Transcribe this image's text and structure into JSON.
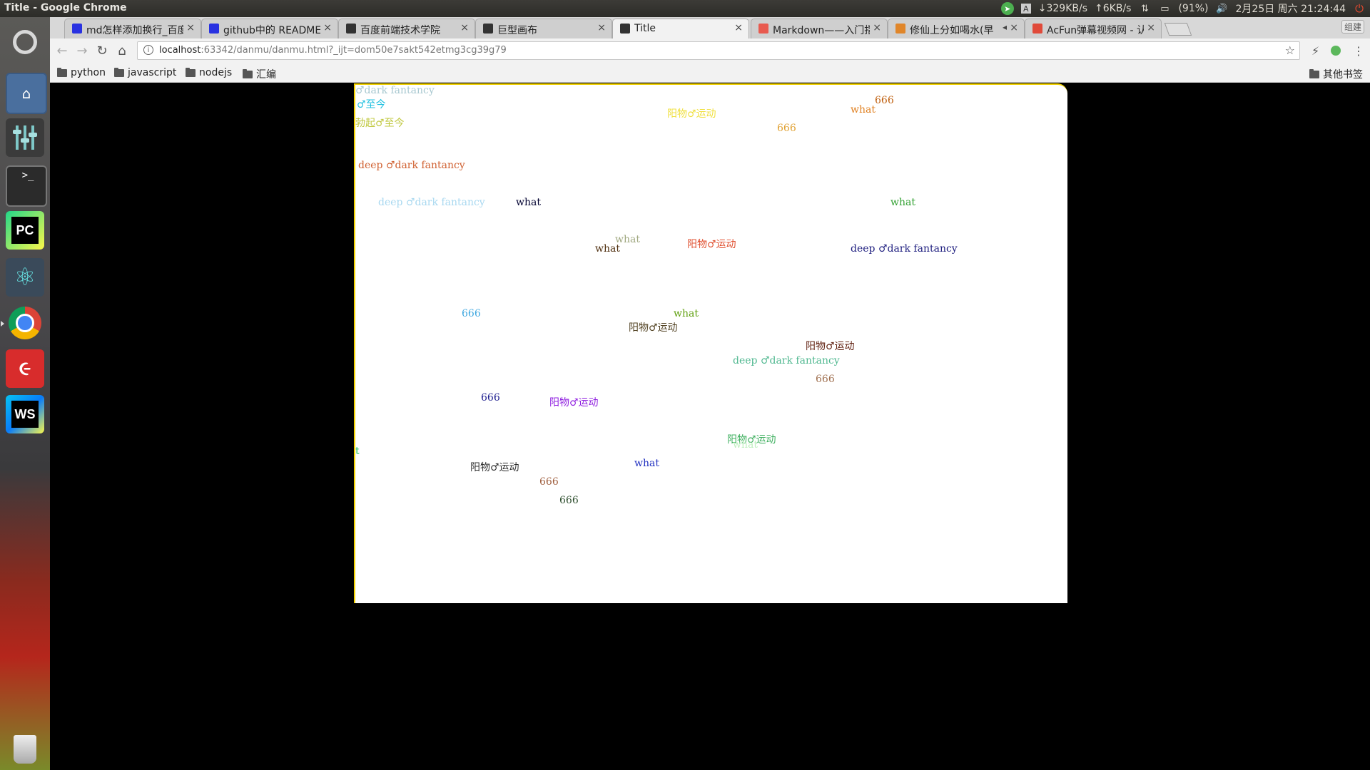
{
  "system": {
    "window_title": "Title - Google Chrome",
    "net_down": "↓329KB/s",
    "net_up": "↑6KB/s",
    "battery": "(91%)",
    "datetime": "2月25日 周六 21:24:44",
    "input_method": "A"
  },
  "launcher": {
    "apps": [
      "ubuntu-dash",
      "files",
      "mixer",
      "terminal",
      "pycharm",
      "atom",
      "chrome",
      "netease-music",
      "webstorm",
      "trash"
    ],
    "terminal_prompt": ">_",
    "pycharm_label": "PC",
    "webstorm_label": "WS"
  },
  "tabs": [
    {
      "label": "md怎样添加换行_百度",
      "favicon": "paw",
      "color": "#2932e1"
    },
    {
      "label": "github中的 README",
      "favicon": "paw",
      "color": "#2932e1"
    },
    {
      "label": "百度前端技术学院",
      "favicon": "circle",
      "color": "#333333"
    },
    {
      "label": "巨型画布",
      "favicon": "circle",
      "color": "#333333"
    },
    {
      "label": "Title",
      "favicon": "ws",
      "color": "#333333",
      "active": true
    },
    {
      "label": "Markdown——入门指",
      "favicon": "md",
      "color": "#e85a4f"
    },
    {
      "label": "修仙上分如喝水(早",
      "favicon": "dy",
      "color": "#e0862a",
      "muted": true
    },
    {
      "label": "AcFun弹幕视频网 - 认",
      "favicon": "ac",
      "color": "#e04a3a"
    }
  ],
  "profile_label": "组建",
  "address_bar": {
    "host": "localhost",
    "rest": ":63342/danmu/danmu.html?_ijt=dom50e7sakt542etmg3cg39g79"
  },
  "bookmarks": [
    "python",
    "javascript",
    "nodejs",
    "汇编"
  ],
  "other_bookmarks": "其他书签",
  "danmu": [
    {
      "text": "♂dark fantancy",
      "color": "#a8c8d0"
    },
    {
      "text": "♂至今",
      "color": "#20c0e0"
    },
    {
      "text": "勃起♂至今",
      "color": "#c0c840"
    },
    {
      "text": "阳物♂运动",
      "color": "#f0e040"
    },
    {
      "text": "what",
      "color": "#e08020"
    },
    {
      "text": "666",
      "color": "#c06010"
    },
    {
      "text": "666",
      "color": "#e0a030"
    },
    {
      "text": "deep ♂dark fantancy",
      "color": "#d06030"
    },
    {
      "text": "deep ♂dark fantancy",
      "color": "#a8d8f0"
    },
    {
      "text": "what",
      "color": "#000030"
    },
    {
      "text": "what",
      "color": "#30a030"
    },
    {
      "text": "what",
      "color": "#a0a880"
    },
    {
      "text": "what",
      "color": "#503010"
    },
    {
      "text": "阳物♂运动",
      "color": "#e05030"
    },
    {
      "text": "deep ♂dark fantancy",
      "color": "#202080"
    },
    {
      "text": "666",
      "color": "#40a8e0"
    },
    {
      "text": "what",
      "color": "#60a010"
    },
    {
      "text": "阳物♂运动",
      "color": "#504020"
    },
    {
      "text": "阳物♂运动",
      "color": "#602010"
    },
    {
      "text": "deep ♂dark fantancy",
      "color": "#50b890"
    },
    {
      "text": "666",
      "color": "#a07050"
    },
    {
      "text": "666",
      "color": "#202090"
    },
    {
      "text": "阳物♂运动",
      "color": "#9020e0"
    },
    {
      "text": "阳物♂运动",
      "color": "#40b060"
    },
    {
      "text": "what",
      "color": "#c0f0c0"
    },
    {
      "text": "t",
      "color": "#20c060"
    },
    {
      "text": "阳物♂运动",
      "color": "#303030"
    },
    {
      "text": "what",
      "color": "#2030c0"
    },
    {
      "text": "666",
      "color": "#a06040"
    },
    {
      "text": "666",
      "color": "#305030"
    }
  ]
}
